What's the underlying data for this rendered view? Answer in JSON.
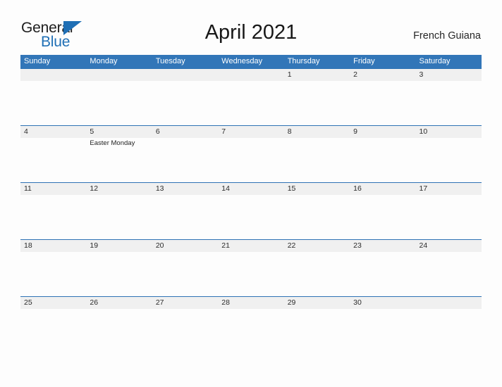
{
  "brand": {
    "name_part1": "General",
    "name_part2": "Blue",
    "triangle_icon": "triangle-icon",
    "color_primary": "#1f6fb5",
    "color_text": "#1d1d1d"
  },
  "header": {
    "title": "April 2021",
    "region": "French Guiana"
  },
  "calendar": {
    "header_bg": "#3276b8",
    "date_band_bg": "#f0f0f0",
    "rule_color": "#2e72b4",
    "day_names": [
      "Sunday",
      "Monday",
      "Tuesday",
      "Wednesday",
      "Thursday",
      "Friday",
      "Saturday"
    ],
    "weeks": [
      {
        "days": [
          {
            "date": "",
            "event": ""
          },
          {
            "date": "",
            "event": ""
          },
          {
            "date": "",
            "event": ""
          },
          {
            "date": "",
            "event": ""
          },
          {
            "date": "1",
            "event": ""
          },
          {
            "date": "2",
            "event": ""
          },
          {
            "date": "3",
            "event": ""
          }
        ]
      },
      {
        "days": [
          {
            "date": "4",
            "event": ""
          },
          {
            "date": "5",
            "event": "Easter Monday"
          },
          {
            "date": "6",
            "event": ""
          },
          {
            "date": "7",
            "event": ""
          },
          {
            "date": "8",
            "event": ""
          },
          {
            "date": "9",
            "event": ""
          },
          {
            "date": "10",
            "event": ""
          }
        ]
      },
      {
        "days": [
          {
            "date": "11",
            "event": ""
          },
          {
            "date": "12",
            "event": ""
          },
          {
            "date": "13",
            "event": ""
          },
          {
            "date": "14",
            "event": ""
          },
          {
            "date": "15",
            "event": ""
          },
          {
            "date": "16",
            "event": ""
          },
          {
            "date": "17",
            "event": ""
          }
        ]
      },
      {
        "days": [
          {
            "date": "18",
            "event": ""
          },
          {
            "date": "19",
            "event": ""
          },
          {
            "date": "20",
            "event": ""
          },
          {
            "date": "21",
            "event": ""
          },
          {
            "date": "22",
            "event": ""
          },
          {
            "date": "23",
            "event": ""
          },
          {
            "date": "24",
            "event": ""
          }
        ]
      },
      {
        "days": [
          {
            "date": "25",
            "event": ""
          },
          {
            "date": "26",
            "event": ""
          },
          {
            "date": "27",
            "event": ""
          },
          {
            "date": "28",
            "event": ""
          },
          {
            "date": "29",
            "event": ""
          },
          {
            "date": "30",
            "event": ""
          },
          {
            "date": "",
            "event": ""
          }
        ]
      }
    ]
  }
}
